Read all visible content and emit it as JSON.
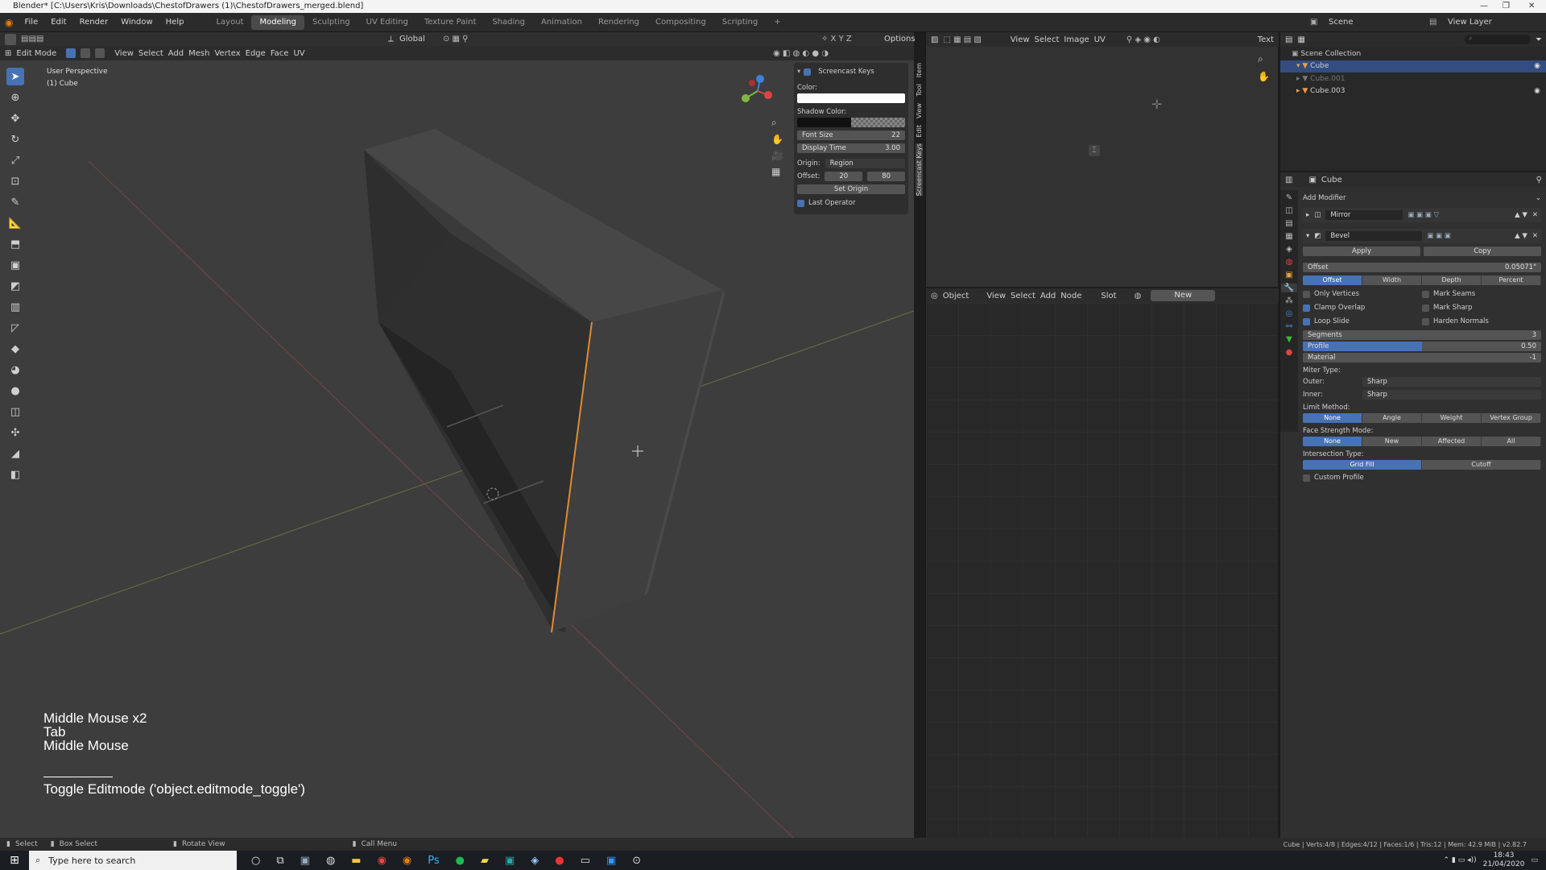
{
  "title": "Blender* [C:\\Users\\Kris\\Downloads\\ChestofDrawers (1)\\ChestofDrawers_merged.blend]",
  "menu": [
    "File",
    "Edit",
    "Render",
    "Window",
    "Help"
  ],
  "workspaces": [
    "Layout",
    "Modeling",
    "Sculpting",
    "UV Editing",
    "Texture Paint",
    "Shading",
    "Animation",
    "Rendering",
    "Compositing",
    "Scripting"
  ],
  "active_workspace": "Modeling",
  "scene": "Scene",
  "view_layer": "View Layer",
  "viewport": {
    "mode": "Edit Mode",
    "menus": [
      "View",
      "Select",
      "Add",
      "Mesh",
      "Vertex",
      "Edge",
      "Face",
      "UV"
    ],
    "orientation": "Global",
    "overlay_title": "User Perspective",
    "overlay_object": "(1) Cube",
    "options": "Options",
    "keys": [
      "Middle Mouse x2",
      "Tab",
      "Middle Mouse"
    ],
    "operator": "Toggle Editmode ('object.editmode_toggle')"
  },
  "screencast": {
    "header": "Screencast Keys",
    "color_label": "Color:",
    "shadow_label": "Shadow Color:",
    "font_size_label": "Font Size",
    "font_size": "22",
    "display_time_label": "Display Time",
    "display_time": "3.00",
    "origin_label": "Origin:",
    "origin": "Region",
    "offset_label": "Offset:",
    "offset_x": "20",
    "offset_y": "80",
    "set_origin": "Set Origin",
    "last_operator": "Last Operator",
    "tabs": [
      "Item",
      "Tool",
      "View",
      "Edit",
      "Screencast Keys"
    ]
  },
  "image_editor": {
    "menus": [
      "View",
      "Select",
      "Image",
      "UV"
    ],
    "text": "Text"
  },
  "node_editor": {
    "object": "Object",
    "menus": [
      "View",
      "Select",
      "Add",
      "Node"
    ],
    "slot": "Slot",
    "new": "New"
  },
  "outliner": {
    "collection": "Scene Collection",
    "items": [
      "Cube",
      "Cube.001",
      "Cube.003"
    ]
  },
  "properties": {
    "object": "Cube",
    "add_modifier": "Add Modifier",
    "mirror": "Mirror",
    "bevel": "Bevel",
    "apply": "Apply",
    "copy": "Copy",
    "offset_label": "Offset",
    "offset_value": "0.05071\"",
    "width_types": [
      "Offset",
      "Width",
      "Depth",
      "Percent"
    ],
    "only_vertices": "Only Vertices",
    "clamp_overlap": "Clamp Overlap",
    "loop_slide": "Loop Slide",
    "mark_seams": "Mark Seams",
    "mark_sharp": "Mark Sharp",
    "harden_normals": "Harden Normals",
    "segments_label": "Segments",
    "segments": "3",
    "profile_label": "Profile",
    "profile": "0.50",
    "profile_fraction": 0.5,
    "material_label": "Material",
    "material": "-1",
    "miter_type": "Miter Type:",
    "outer_label": "Outer:",
    "outer": "Sharp",
    "inner_label": "Inner:",
    "inner": "Sharp",
    "limit_method": "Limit Method:",
    "limit_options": [
      "None",
      "Angle",
      "Weight",
      "Vertex Group"
    ],
    "face_strength": "Face Strength Mode:",
    "face_options": [
      "None",
      "New",
      "Affected",
      "All"
    ],
    "intersection": "Intersection Type:",
    "intersection_options": [
      "Grid Fill",
      "Cutoff"
    ],
    "custom_profile": "Custom Profile"
  },
  "statusbar": {
    "select": "Select",
    "box_select": "Box Select",
    "rotate": "Rotate View",
    "call_menu": "Call Menu",
    "stats": "Cube | Verts:4/8 | Edges:4/12 | Faces:1/6 | Tris:12 | Mem: 42.9 MiB | v2.82.7"
  },
  "taskbar": {
    "search": "Type here to search",
    "time": "18:43",
    "date": "21/04/2020"
  },
  "colors": {
    "accent": "#4772b3",
    "edge_select": "#e08a30",
    "bg": "#3d3d3d"
  }
}
